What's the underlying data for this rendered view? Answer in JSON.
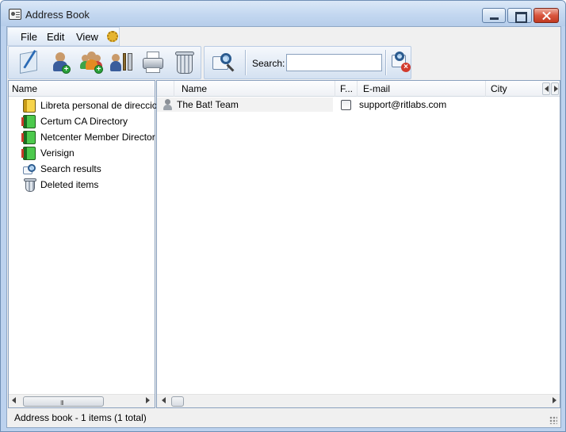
{
  "window": {
    "title": "Address Book",
    "icon": "address-book-icon"
  },
  "menu": {
    "file": "File",
    "edit": "Edit",
    "view": "View"
  },
  "toolbar": {
    "buttons": [
      {
        "name": "new-note",
        "icon": "note-pen-icon"
      },
      {
        "name": "add-contact",
        "icon": "add-contact-icon"
      },
      {
        "name": "add-group",
        "icon": "add-group-icon"
      },
      {
        "name": "properties",
        "icon": "tools-icon"
      },
      {
        "name": "print",
        "icon": "printer-icon"
      },
      {
        "name": "delete",
        "icon": "trash-icon"
      },
      {
        "name": "find",
        "icon": "search-card-icon"
      },
      {
        "name": "clear-search",
        "icon": "clear-search-icon"
      }
    ],
    "search_label": "Search:",
    "search_value": ""
  },
  "tree": {
    "header": "Name",
    "items": [
      {
        "label": "Libreta personal de direccio",
        "icon": "yellow-book-icon"
      },
      {
        "label": "Certum CA Directory",
        "icon": "green-book-icon"
      },
      {
        "label": "Netcenter Member Director",
        "icon": "green-book-icon"
      },
      {
        "label": "Verisign",
        "icon": "green-book-icon"
      },
      {
        "label": "Search results",
        "icon": "search-icon"
      },
      {
        "label": "Deleted items",
        "icon": "trash-icon"
      }
    ]
  },
  "list": {
    "columns": [
      "Name",
      "F...",
      "E-mail",
      "City"
    ],
    "rows": [
      {
        "name": "The Bat! Team",
        "flag": false,
        "email": "support@ritlabs.com",
        "city": ""
      }
    ]
  },
  "status": {
    "text": "Address book - 1 items (1 total)"
  },
  "scrollbar": {
    "grip": "III"
  }
}
